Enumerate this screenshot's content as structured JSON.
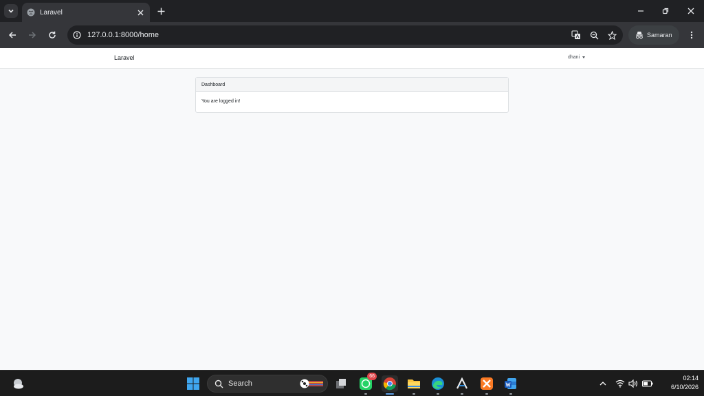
{
  "browser": {
    "tab_title": "Laravel",
    "url": "127.0.0.1:8000/home",
    "profile_label": "Samaran"
  },
  "app": {
    "brand": "Laravel",
    "user_name": "dhani"
  },
  "card": {
    "header": "Dashboard",
    "body": "You are logged in!"
  },
  "taskbar": {
    "search_label": "Search",
    "whatsapp_badge": "66",
    "time": "02:14",
    "date": "6/10/2026"
  },
  "colors": {
    "chrome_dark": "#202124",
    "chrome_toolbar": "#35363a",
    "page_bg": "#f8f9fa",
    "taskbar": "#1c1c1c"
  },
  "icons": [
    "tab-search-icon",
    "globe-icon",
    "close-icon",
    "plus-icon",
    "minimize-icon",
    "restore-icon",
    "back-icon",
    "forward-icon",
    "reload-icon",
    "info-icon",
    "translate-icon",
    "zoom-icon",
    "star-icon",
    "incognito-icon",
    "kebab-menu-icon",
    "windows-start-icon",
    "search-icon",
    "task-view-icon",
    "whatsapp-icon",
    "chrome-icon",
    "file-explorer-icon",
    "edge-icon",
    "arduino-icon",
    "xampp-icon",
    "word-icon",
    "chevron-up-icon",
    "wifi-icon",
    "volume-icon",
    "battery-icon",
    "weather-icon"
  ]
}
